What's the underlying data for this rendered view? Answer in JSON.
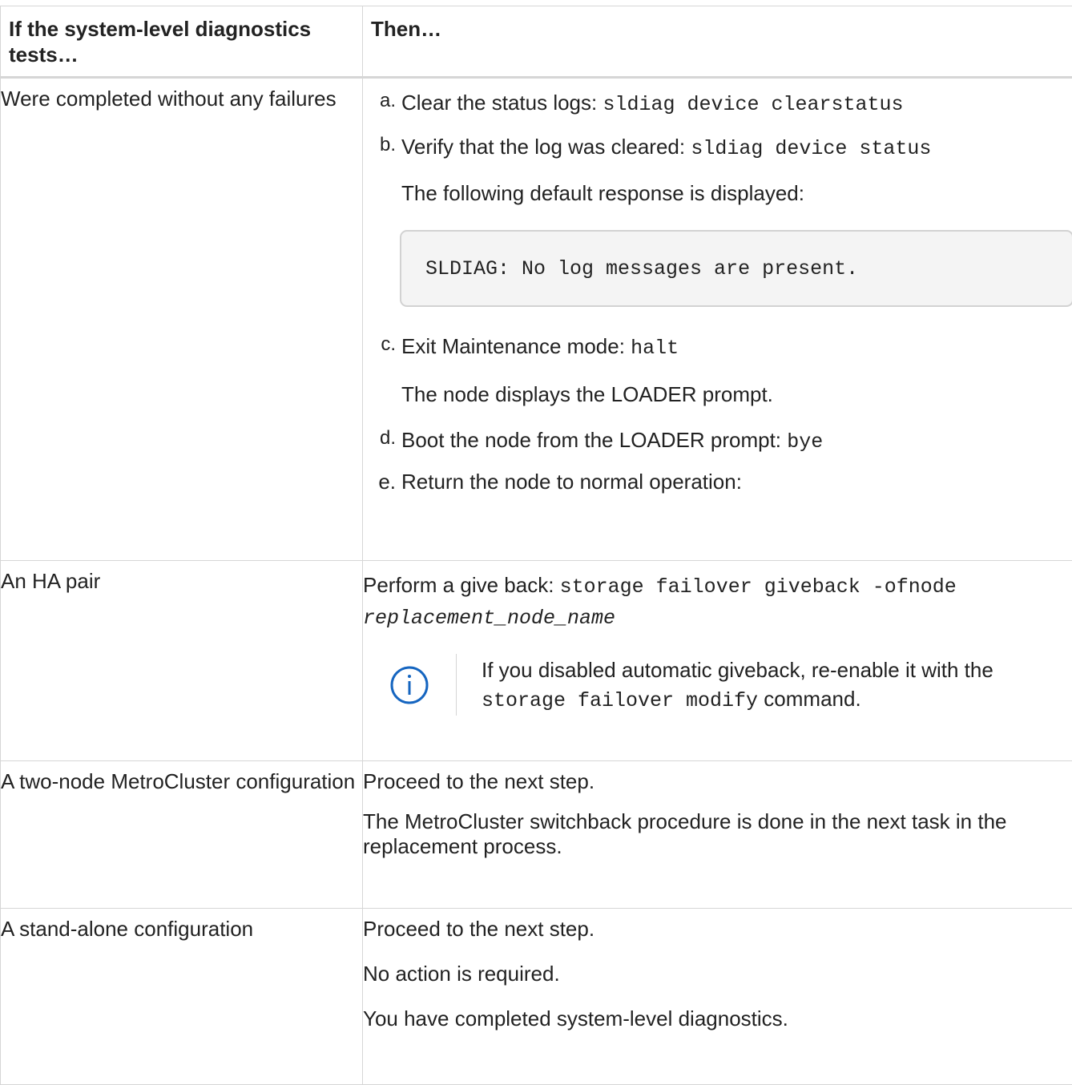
{
  "table": {
    "headers": [
      "If the system-level diagnostics tests…",
      "Then…"
    ],
    "rows": [
      {
        "condition": "Were completed without any failures",
        "steps": [
          {
            "marker": "a.",
            "text": "Clear the status logs: ",
            "code": "sldiag device clearstatus"
          },
          {
            "marker": "b.",
            "text": "Verify that the log was cleared: ",
            "code": "sldiag device status"
          }
        ],
        "b_followup": "The following default response is displayed:",
        "code_block": "SLDIAG: No log messages are present.",
        "step_c": {
          "marker": "c.",
          "text": "Exit Maintenance mode: ",
          "code": "halt"
        },
        "c_followup": "The node displays the LOADER prompt.",
        "step_d": {
          "marker": "d.",
          "text": "Boot the node from the LOADER prompt: ",
          "code": "bye"
        },
        "step_e": {
          "marker": "e.",
          "text": "Return the node to normal operation:"
        }
      },
      {
        "condition": "An HA pair",
        "action_text": "Perform a give back: ",
        "action_code": "storage failover giveback -ofnode",
        "action_code_italic": "replacement_node_name",
        "note": {
          "icon": "info-circle-icon",
          "text_before": "If you disabled automatic giveback, re-enable it with the ",
          "code": "storage failover modify",
          "text_after": " command."
        }
      },
      {
        "condition": "A two-node MetroCluster configuration",
        "lines": [
          "Proceed to the next step.",
          "The MetroCluster switchback procedure is done in the next task in the replacement process."
        ]
      },
      {
        "condition": "A stand-alone configuration",
        "lines": [
          "Proceed to the next step.",
          "No action is required.",
          "You have completed system-level diagnostics."
        ]
      }
    ]
  },
  "colors": {
    "border": "#d6d6d6",
    "code_bg": "#f4f4f4",
    "info_icon": "#1565c0"
  }
}
